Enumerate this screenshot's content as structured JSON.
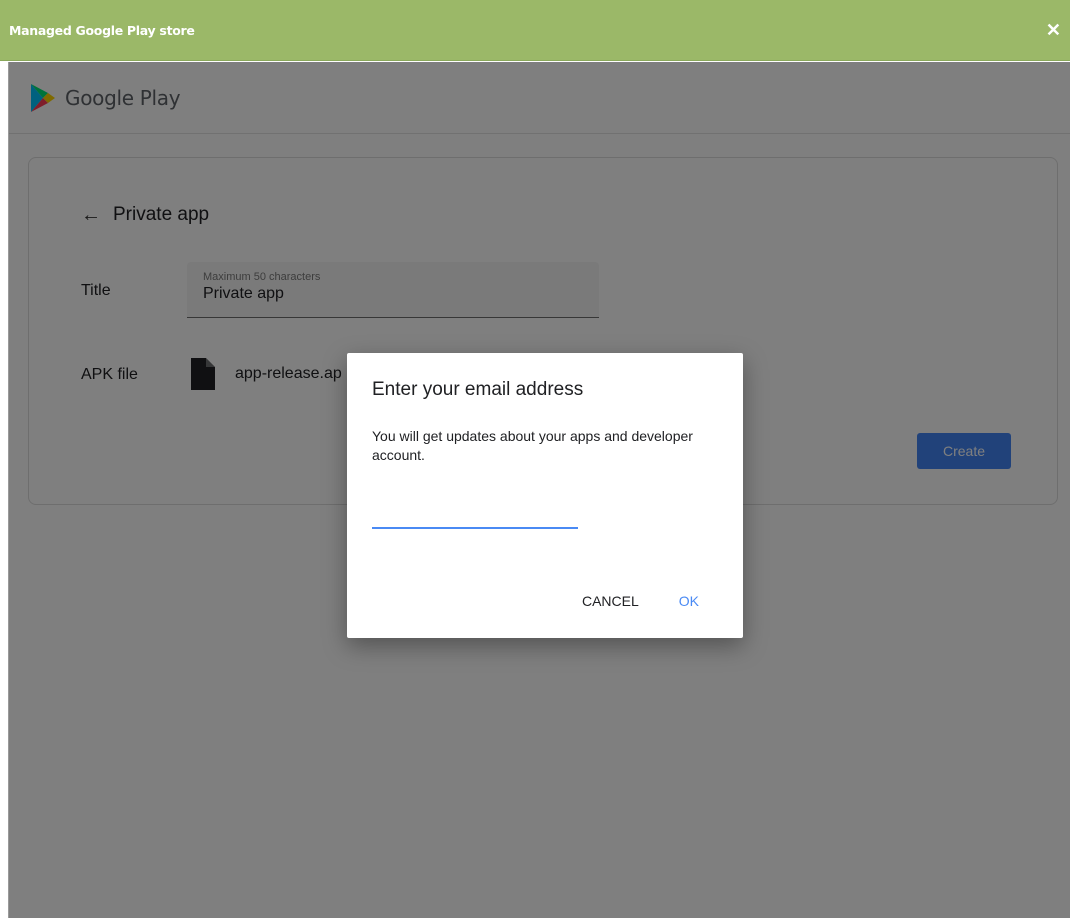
{
  "window": {
    "title": "Managed Google Play store",
    "close_glyph": "✕"
  },
  "header": {
    "logo_text": "Google Play",
    "logo_icon": "google-play-icon"
  },
  "card": {
    "back_icon": "arrow-left-icon",
    "back_glyph": "←",
    "title": "Private app",
    "title_field": {
      "label": "Title",
      "hint": "Maximum 50 characters",
      "value": "Private app"
    },
    "apk": {
      "label": "APK file",
      "icon": "file-icon",
      "file_name": "app-release.ap"
    },
    "create_label": "Create"
  },
  "dialog": {
    "title": "Enter your email address",
    "body": "You will get updates about your apps and developer account.",
    "input_value": "",
    "cancel_label": "CANCEL",
    "ok_label": "OK"
  },
  "colors": {
    "topbar": "#9bb868",
    "primary_blue": "#4285f4",
    "overlay": "rgba(0,0,0,0.5)"
  }
}
